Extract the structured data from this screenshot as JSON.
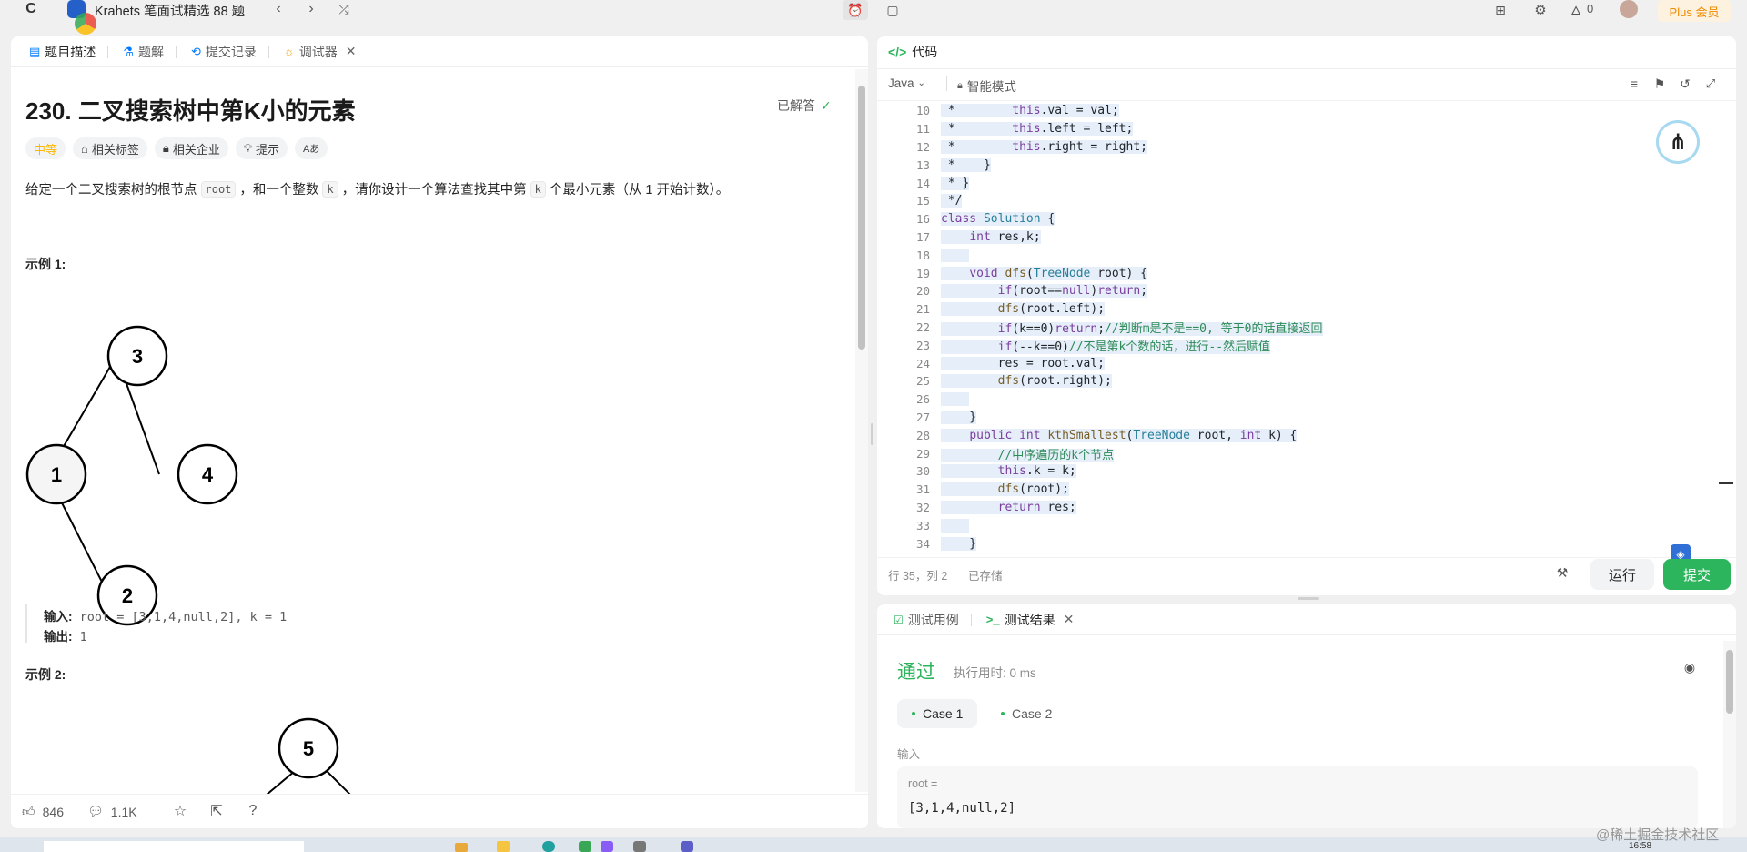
{
  "topbar": {
    "title": "Krahets 笔面试精选 88 题",
    "streak": "0",
    "plus": "Plus 会员"
  },
  "left": {
    "tabs": [
      "题目描述",
      "题解",
      "提交记录",
      "调试器"
    ],
    "problem_title": "230. 二叉搜索树中第K小的元素",
    "solved": "已解答",
    "pills": [
      "中等",
      "相关标签",
      "相关企业",
      "提示",
      "Aあ"
    ],
    "desc": {
      "p1": "给定一个二叉搜索树的根节点",
      "code1": "root",
      "p2": "，和一个整数",
      "code2": "k",
      "p3": "，请你设计一个算法查找其中第",
      "code3": "k",
      "p4": "个最小元素（从 1 开始计数）。"
    },
    "example1": {
      "heading": "示例 1:",
      "nodes": [
        "3",
        "1",
        "4",
        "2"
      ],
      "input_label": "输入:",
      "input": "root = [3,1,4,null,2], k = 1",
      "output_label": "输出:",
      "output": "1"
    },
    "example2": {
      "heading": "示例 2:",
      "nodes": [
        "5"
      ]
    },
    "footer": {
      "likes": "846",
      "comments": "1.1K"
    }
  },
  "editor": {
    "header": "代码",
    "language": "Java",
    "mode": "智能模式",
    "lines": [
      {
        "n": "10",
        "tokens": [
          [
            "v",
            " *        "
          ],
          [
            "k",
            "this"
          ],
          [
            "v",
            ".val = val;"
          ]
        ]
      },
      {
        "n": "11",
        "tokens": [
          [
            "v",
            " *        "
          ],
          [
            "k",
            "this"
          ],
          [
            "v",
            ".left = left;"
          ]
        ]
      },
      {
        "n": "12",
        "tokens": [
          [
            "v",
            " *        "
          ],
          [
            "k",
            "this"
          ],
          [
            "v",
            ".right = right;"
          ]
        ]
      },
      {
        "n": "13",
        "tokens": [
          [
            "v",
            " *    }"
          ]
        ]
      },
      {
        "n": "14",
        "tokens": [
          [
            "v",
            " * }"
          ]
        ]
      },
      {
        "n": "15",
        "tokens": [
          [
            "v",
            " */"
          ]
        ]
      },
      {
        "n": "16",
        "tokens": [
          [
            "k",
            "class "
          ],
          [
            "t",
            "Solution"
          ],
          [
            "v",
            " {"
          ]
        ]
      },
      {
        "n": "17",
        "tokens": [
          [
            "v",
            "    "
          ],
          [
            "k",
            "int"
          ],
          [
            "v",
            " res,k;"
          ]
        ]
      },
      {
        "n": "18",
        "tokens": [
          [
            "v",
            "    "
          ]
        ]
      },
      {
        "n": "19",
        "tokens": [
          [
            "v",
            "    "
          ],
          [
            "k",
            "void"
          ],
          [
            "v",
            " "
          ],
          [
            "f",
            "dfs"
          ],
          [
            "v",
            "("
          ],
          [
            "t",
            "TreeNode"
          ],
          [
            "v",
            " root) {"
          ]
        ]
      },
      {
        "n": "20",
        "tokens": [
          [
            "v",
            "        "
          ],
          [
            "k",
            "if"
          ],
          [
            "v",
            "(root=="
          ],
          [
            "k",
            "null"
          ],
          [
            "v",
            ")"
          ],
          [
            "k",
            "return"
          ],
          [
            "v",
            ";"
          ]
        ]
      },
      {
        "n": "21",
        "tokens": [
          [
            "v",
            "        "
          ],
          [
            "f",
            "dfs"
          ],
          [
            "v",
            "(root.left);"
          ]
        ]
      },
      {
        "n": "22",
        "tokens": [
          [
            "v",
            "        "
          ],
          [
            "k",
            "if"
          ],
          [
            "v",
            "(k==0)"
          ],
          [
            "k",
            "return"
          ],
          [
            "v",
            ";"
          ],
          [
            "c",
            "//判断m是不是==0, 等于0的话直接返回"
          ]
        ]
      },
      {
        "n": "23",
        "tokens": [
          [
            "v",
            "        "
          ],
          [
            "k",
            "if"
          ],
          [
            "v",
            "(--k==0)"
          ],
          [
            "c",
            "//不是第k个数的话，进行--然后赋值"
          ]
        ]
      },
      {
        "n": "24",
        "tokens": [
          [
            "v",
            "        res = root.val;"
          ]
        ]
      },
      {
        "n": "25",
        "tokens": [
          [
            "v",
            "        "
          ],
          [
            "f",
            "dfs"
          ],
          [
            "v",
            "(root.right);"
          ]
        ]
      },
      {
        "n": "26",
        "tokens": [
          [
            "v",
            "    "
          ]
        ]
      },
      {
        "n": "27",
        "tokens": [
          [
            "v",
            "    }"
          ]
        ]
      },
      {
        "n": "28",
        "tokens": [
          [
            "v",
            "    "
          ],
          [
            "k",
            "public int"
          ],
          [
            "v",
            " "
          ],
          [
            "f",
            "kthSmallest"
          ],
          [
            "v",
            "("
          ],
          [
            "t",
            "TreeNode"
          ],
          [
            "v",
            " root, "
          ],
          [
            "k",
            "int"
          ],
          [
            "v",
            " k) {"
          ]
        ]
      },
      {
        "n": "29",
        "tokens": [
          [
            "v",
            "        "
          ],
          [
            "c",
            "//中序遍历的k个节点"
          ]
        ]
      },
      {
        "n": "30",
        "tokens": [
          [
            "v",
            "        "
          ],
          [
            "k",
            "this"
          ],
          [
            "v",
            ".k = k;"
          ]
        ]
      },
      {
        "n": "31",
        "tokens": [
          [
            "v",
            "        "
          ],
          [
            "f",
            "dfs"
          ],
          [
            "v",
            "(root);"
          ]
        ]
      },
      {
        "n": "32",
        "tokens": [
          [
            "v",
            "        "
          ],
          [
            "k",
            "return"
          ],
          [
            "v",
            " res;"
          ]
        ]
      },
      {
        "n": "33",
        "tokens": [
          [
            "v",
            "    "
          ]
        ]
      },
      {
        "n": "34",
        "tokens": [
          [
            "v",
            "    }"
          ]
        ]
      }
    ],
    "status_pos": "行 35，列 2",
    "status_saved": "已存储",
    "run": "运行",
    "submit": "提交"
  },
  "results": {
    "tabs": [
      "测试用例",
      "测试结果"
    ],
    "status": "通过",
    "runtime": "执行用时: 0 ms",
    "cases": [
      "Case 1",
      "Case 2"
    ],
    "input_label": "输入",
    "var_label": "root =",
    "var_value": "[3,1,4,null,2]"
  },
  "taskbar": {
    "clock": "16:58"
  },
  "watermark": "@稀土掘金技术社区",
  "colors": {
    "accent_green": "#2db55d",
    "difficulty": "#ffb800",
    "plus": "#f08a00"
  }
}
